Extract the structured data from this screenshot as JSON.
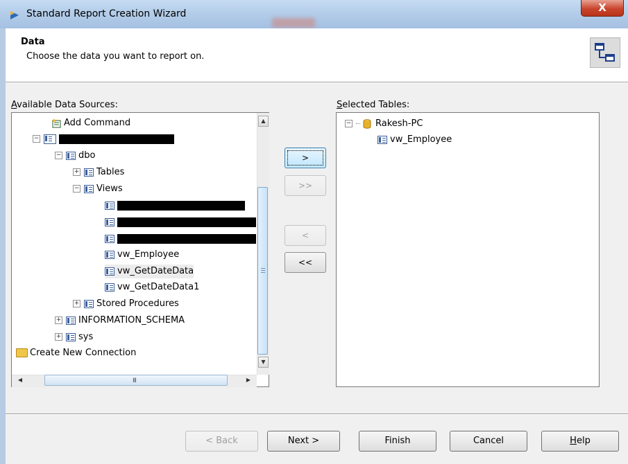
{
  "window": {
    "title": "Standard Report Creation Wizard",
    "close_label": "X"
  },
  "header": {
    "title": "Data",
    "subtitle": "Choose the data you want to report on."
  },
  "labels": {
    "available_prefix": "A",
    "available_rest": "vailable Data Sources:",
    "selected_prefix": "S",
    "selected_rest": "elected Tables:"
  },
  "tree": {
    "add_command": "Add Command",
    "schemas": {
      "dbo": "dbo",
      "tables": "Tables",
      "views": "Views",
      "stored_procedures": "Stored Procedures",
      "information_schema": "INFORMATION_SCHEMA",
      "sys": "sys"
    },
    "views": [
      "vw_Employee",
      "vw_GetDateData",
      "vw_GetDateData1"
    ],
    "create_new_connection": "Create New Connection"
  },
  "transfer": {
    "add": ">",
    "add_all": ">>",
    "remove": "<",
    "remove_all": "<<"
  },
  "selected": {
    "server": "Rakesh-PC",
    "tables": [
      "vw_Employee"
    ]
  },
  "footer": {
    "back": "< Back",
    "next": "Next >",
    "finish": "Finish",
    "cancel": "Cancel",
    "help_prefix": "H",
    "help_rest": "elp"
  },
  "scrollbar": {
    "h_grip": "III"
  }
}
